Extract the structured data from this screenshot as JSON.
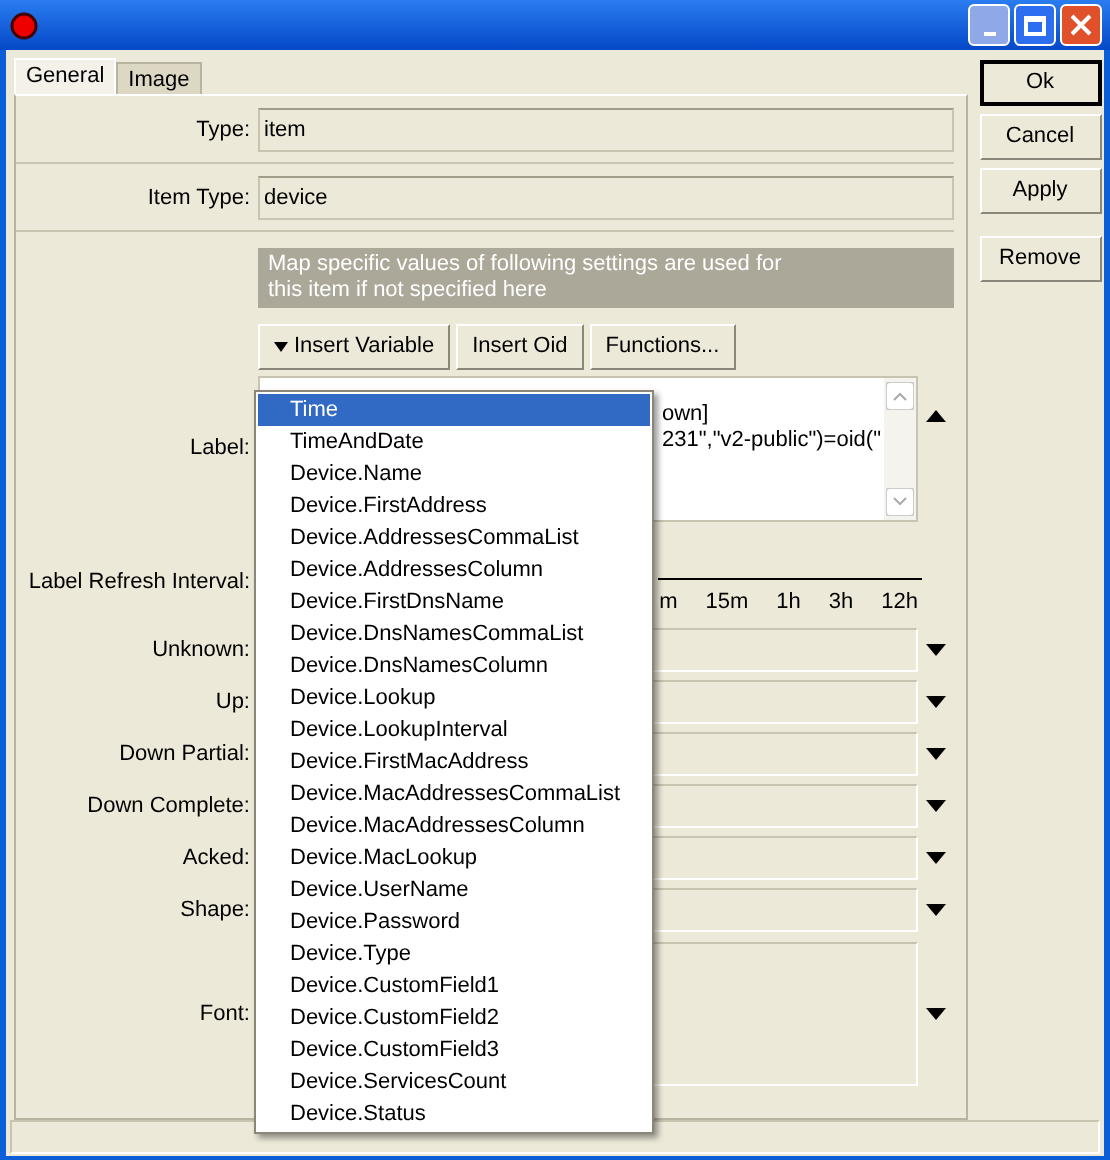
{
  "tabs": [
    {
      "label": "General",
      "selected": true
    },
    {
      "label": "Image",
      "selected": false
    }
  ],
  "fields": [
    {
      "label": "Type:",
      "value": "item"
    },
    {
      "label": "Item Type:",
      "value": "device"
    }
  ],
  "info": "Map specific values of following settings are used for this item if not specified here",
  "toolbar": [
    {
      "label": "Insert Variable",
      "kind": "menu"
    },
    {
      "label": "Insert Oid",
      "kind": "plain"
    },
    {
      "label": "Functions...",
      "kind": "plain"
    }
  ],
  "label_field": {
    "label": "Label:",
    "lines": [
      "own]",
      "231\",\"v2-public\")=oid(\""
    ]
  },
  "refresh": {
    "label": "Label Refresh Interval:",
    "ticks": [
      "m",
      "15m",
      "1h",
      "3h",
      "12h"
    ]
  },
  "selects": [
    {
      "label": "Unknown:"
    },
    {
      "label": "Up:"
    },
    {
      "label": "Down Partial:"
    },
    {
      "label": "Down Complete:"
    },
    {
      "label": "Acked:"
    },
    {
      "label": "Shape:"
    }
  ],
  "font": {
    "label": "Font:"
  },
  "side_buttons": [
    {
      "label": "Ok",
      "default": true
    },
    {
      "label": "Cancel",
      "default": false
    },
    {
      "label": "Apply",
      "default": false
    },
    {
      "label": "Remove",
      "default": false
    }
  ],
  "menu": [
    {
      "label": "Time",
      "selected": true
    },
    {
      "label": "TimeAndDate",
      "selected": false
    },
    {
      "label": "Device.Name",
      "selected": false
    },
    {
      "label": "Device.FirstAddress",
      "selected": false
    },
    {
      "label": "Device.AddressesCommaList",
      "selected": false
    },
    {
      "label": "Device.AddressesColumn",
      "selected": false
    },
    {
      "label": "Device.FirstDnsName",
      "selected": false
    },
    {
      "label": "Device.DnsNamesCommaList",
      "selected": false
    },
    {
      "label": "Device.DnsNamesColumn",
      "selected": false
    },
    {
      "label": "Device.Lookup",
      "selected": false
    },
    {
      "label": "Device.LookupInterval",
      "selected": false
    },
    {
      "label": "Device.FirstMacAddress",
      "selected": false
    },
    {
      "label": "Device.MacAddressesCommaList",
      "selected": false
    },
    {
      "label": "Device.MacAddressesColumn",
      "selected": false
    },
    {
      "label": "Device.MacLookup",
      "selected": false
    },
    {
      "label": "Device.UserName",
      "selected": false
    },
    {
      "label": "Device.Password",
      "selected": false
    },
    {
      "label": "Device.Type",
      "selected": false
    },
    {
      "label": "Device.CustomField1",
      "selected": false
    },
    {
      "label": "Device.CustomField2",
      "selected": false
    },
    {
      "label": "Device.CustomField3",
      "selected": false
    },
    {
      "label": "Device.ServicesCount",
      "selected": false
    },
    {
      "label": "Device.Status",
      "selected": false
    }
  ]
}
